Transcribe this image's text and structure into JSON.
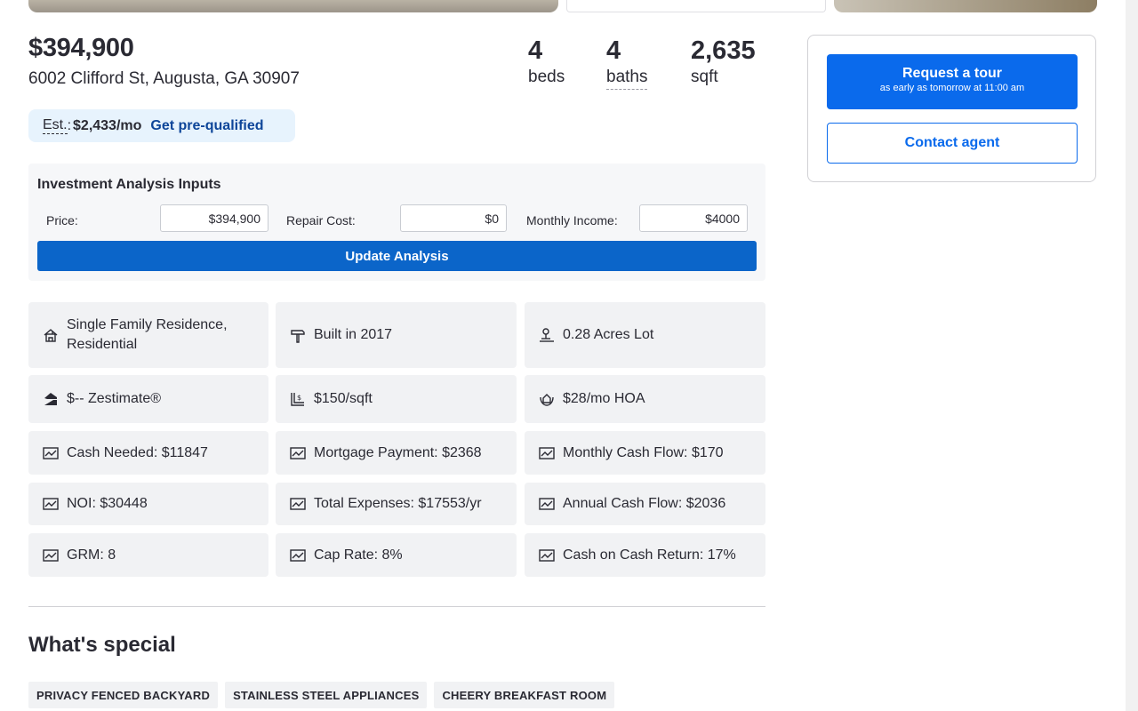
{
  "summary": {
    "price": "$394,900",
    "address": "6002 Clifford St, Augusta, GA 30907",
    "beds": {
      "value": "4",
      "label": "beds"
    },
    "baths": {
      "value": "4",
      "label": "baths"
    },
    "sqft": {
      "value": "2,635",
      "label": "sqft"
    },
    "estimate": {
      "label": "Est.",
      "amount": "$2,433/mo",
      "link": "Get pre-qualified"
    }
  },
  "investment": {
    "title": "Investment Analysis Inputs",
    "price_label": "Price:",
    "price_value": "$394,900",
    "repair_label": "Repair Cost:",
    "repair_value": "$0",
    "income_label": "Monthly Income:",
    "income_value": "$4000",
    "button": "Update Analysis"
  },
  "facts": [
    {
      "icon": "home-type-icon",
      "text": "Single Family Residence, Residential"
    },
    {
      "icon": "hammer-icon",
      "text": "Built in 2017"
    },
    {
      "icon": "lot-icon",
      "text": "0.28 Acres Lot"
    },
    {
      "icon": "zestimate-icon",
      "text": "$-- Zestimate®"
    },
    {
      "icon": "price-per-sqft-icon",
      "text": "$150/sqft"
    },
    {
      "icon": "hoa-icon",
      "text": "$28/mo HOA"
    },
    {
      "icon": "chart-icon",
      "text": "Cash Needed: $11847"
    },
    {
      "icon": "chart-icon",
      "text": "Mortgage Payment: $2368"
    },
    {
      "icon": "chart-icon",
      "text": "Monthly Cash Flow: $170"
    },
    {
      "icon": "chart-icon",
      "text": "NOI: $30448"
    },
    {
      "icon": "chart-icon",
      "text": "Total Expenses: $17553/yr"
    },
    {
      "icon": "chart-icon",
      "text": "Annual Cash Flow: $2036"
    },
    {
      "icon": "chart-icon",
      "text": "GRM: 8"
    },
    {
      "icon": "chart-icon",
      "text": "Cap Rate: 8%"
    },
    {
      "icon": "chart-icon",
      "text": "Cash on Cash Return: 17%"
    }
  ],
  "special": {
    "title": "What's special",
    "tags": [
      "PRIVACY FENCED BACKYARD",
      "STAINLESS STEEL APPLIANCES",
      "CHEERY BREAKFAST ROOM"
    ]
  },
  "sidebar": {
    "tour_label": "Request a tour",
    "tour_sub": "as early as tomorrow at 11:00 am",
    "contact_label": "Contact agent"
  },
  "colors": {
    "primary": "#0a6aec",
    "update_button": "#0b65c9",
    "link": "#0d4599",
    "pill_bg": "#e7f3fd"
  }
}
